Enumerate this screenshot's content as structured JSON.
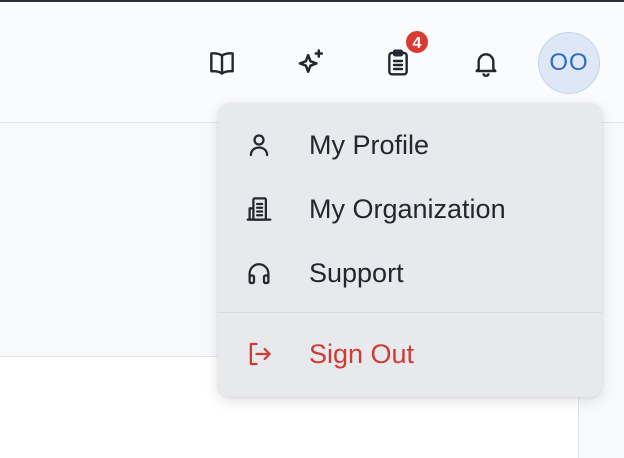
{
  "header": {
    "icons": {
      "docs": "book-open-icon",
      "ai": "sparkles-icon",
      "tasks": "clipboard-list-icon",
      "notifications": "bell-icon"
    },
    "tasks_badge": "4",
    "avatar_initials": "OO"
  },
  "user_menu": {
    "items": [
      {
        "label": "My Profile",
        "icon": "user-icon"
      },
      {
        "label": "My Organization",
        "icon": "building-icon"
      },
      {
        "label": "Support",
        "icon": "headphones-icon"
      }
    ],
    "sign_out": {
      "label": "Sign Out",
      "icon": "sign-out-icon"
    }
  },
  "colors": {
    "badge": "#d93b32",
    "avatar_text": "#2f6bc4",
    "avatar_bg": "#dde7f5",
    "sign_out": "#cf3a33",
    "menu_bg": "#e7e9ed",
    "text": "#23272e"
  }
}
